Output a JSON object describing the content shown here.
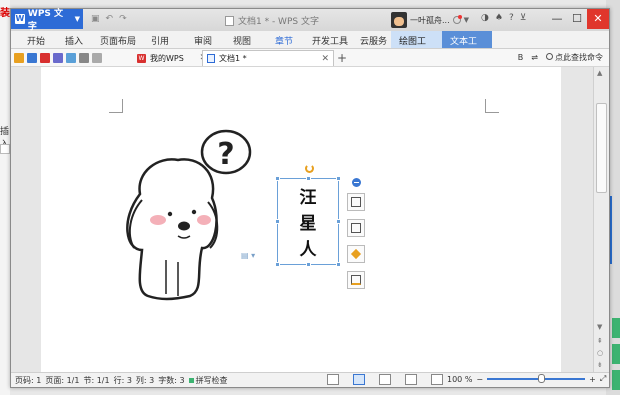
{
  "background": {
    "frag_top": "装",
    "frag_mid": "插入"
  },
  "window": {
    "app_button": "WPS 文字",
    "title": "文档1 * - WPS 文字",
    "user_name": "一叶孤舟..."
  },
  "ribbon": {
    "tabs": [
      "开始",
      "插入",
      "页面布局",
      "引用",
      "审阅",
      "视图",
      "章节",
      "开发工具",
      "云服务"
    ],
    "context_tabs": [
      "绘图工具",
      "文本工具"
    ]
  },
  "docbar": {
    "tab_mywps": "我的WPS",
    "tab_doc": "文档1 *",
    "search_label": "点此查找命令"
  },
  "document": {
    "question_mark": "?",
    "textbox_lines": [
      "汪",
      "星",
      "人"
    ]
  },
  "status": {
    "page_num": "页码: 1",
    "page_count": "页面: 1/1",
    "section": "节: 1/1",
    "row": "行: 3",
    "col": "列: 3",
    "words": "字数: 3",
    "spell": "拼写检查",
    "zoom": "100 %",
    "zoom_fraction": 0.55
  },
  "colors": {
    "app_blue": "#2d6bd6",
    "close_red": "#e0362c",
    "selection": "#6aa0d8",
    "accent_orange": "#e8a020"
  }
}
